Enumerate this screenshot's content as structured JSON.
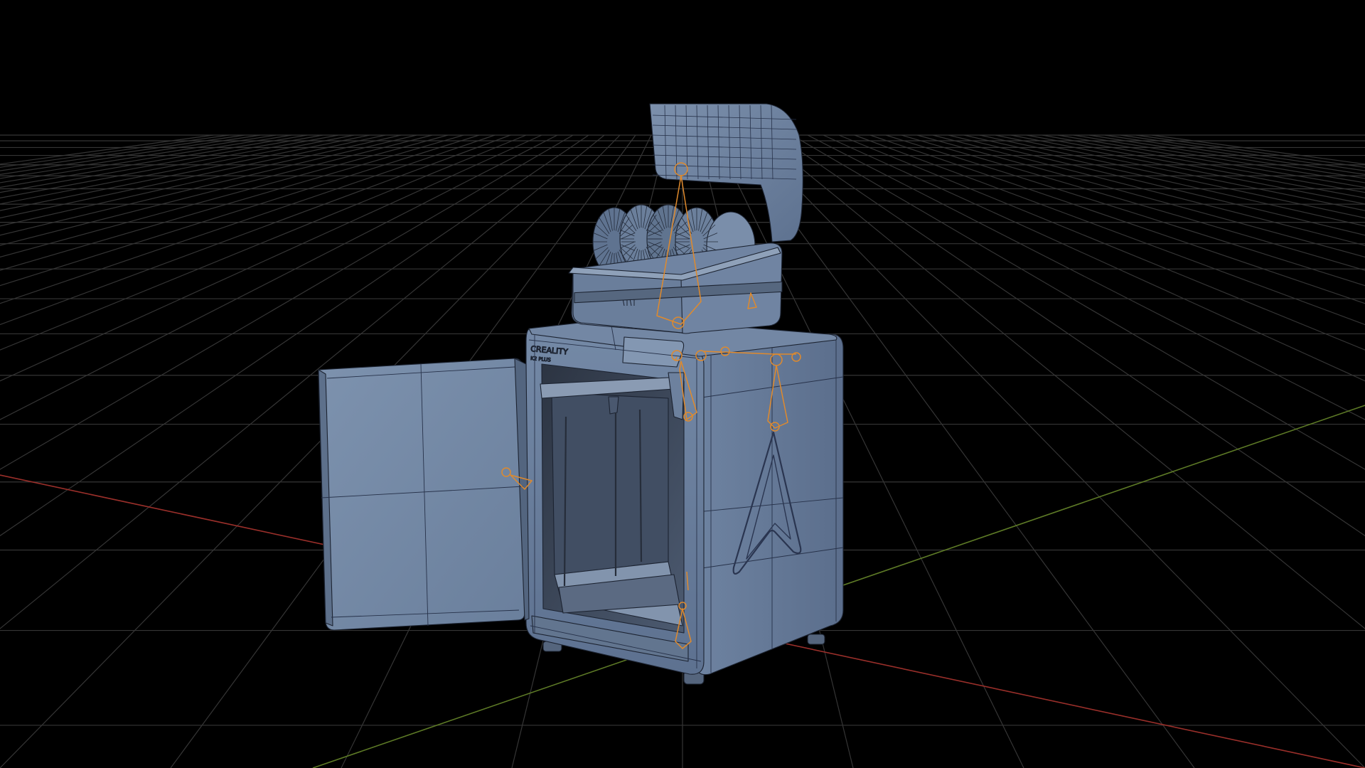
{
  "viewport": {
    "background": "#000000",
    "grid_color": "#3a3a3a",
    "axis_x_color": "#c0392b",
    "axis_y_color": "#6b8e23",
    "mesh_fill": "#6f85a3",
    "mesh_wire": "#1c2331",
    "rig_color": "#e08a2c"
  },
  "model": {
    "brand_label": "CREALITY",
    "brand_sub": "K2 PLUS"
  }
}
